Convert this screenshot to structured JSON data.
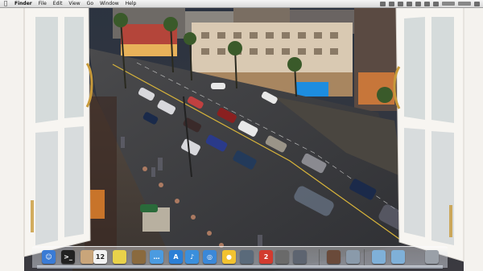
{
  "menubar": {
    "apple_icon": "apple-logo-icon",
    "items": [
      "Finder",
      "File",
      "Edit",
      "View",
      "Go",
      "Window",
      "Help"
    ]
  },
  "dock": {
    "items": [
      {
        "name": "finder-icon",
        "color": "#3a7bd5",
        "glyph": "☺"
      },
      {
        "name": "terminal-icon",
        "color": "#222222",
        "glyph": ">_"
      },
      {
        "name": "preview-icon",
        "color": "#c9a57a",
        "glyph": ""
      },
      {
        "name": "ical-icon",
        "color": "#f2f2f2",
        "glyph": "12"
      },
      {
        "name": "stickies-icon",
        "color": "#e9d24a",
        "glyph": ""
      },
      {
        "name": "address-book-icon",
        "color": "#8a6a3e",
        "glyph": ""
      },
      {
        "name": "ichat-icon",
        "color": "#4b9be0",
        "glyph": "…"
      },
      {
        "name": "app-store-icon",
        "color": "#2b7fd6",
        "glyph": "A"
      },
      {
        "name": "itunes-icon",
        "color": "#3b8fdc",
        "glyph": "♪"
      },
      {
        "name": "safari-icon",
        "color": "#3b88d8",
        "glyph": "◎"
      },
      {
        "name": "chrome-icon",
        "color": "#f2c230",
        "glyph": "●"
      },
      {
        "name": "iphoto-icon",
        "color": "#5a6a7a",
        "glyph": ""
      },
      {
        "name": "system-preferences-badge-icon",
        "color": "#d23b2f",
        "glyph": "2"
      },
      {
        "name": "photo-booth-icon",
        "color": "#6a6a6a",
        "glyph": ""
      },
      {
        "name": "time-machine-icon",
        "color": "#5d6470",
        "glyph": ""
      },
      {
        "name": "downloads-stack-icon",
        "color": "#6a4a3a",
        "glyph": ""
      },
      {
        "name": "documents-stack-icon",
        "color": "#8a9aaa",
        "glyph": ""
      },
      {
        "name": "applications-folder-icon",
        "color": "#7fb0d8",
        "glyph": ""
      },
      {
        "name": "documents-folder-icon",
        "color": "#7fb0d8",
        "glyph": ""
      },
      {
        "name": "trash-icon",
        "color": "#9aa0a8",
        "glyph": ""
      }
    ]
  }
}
